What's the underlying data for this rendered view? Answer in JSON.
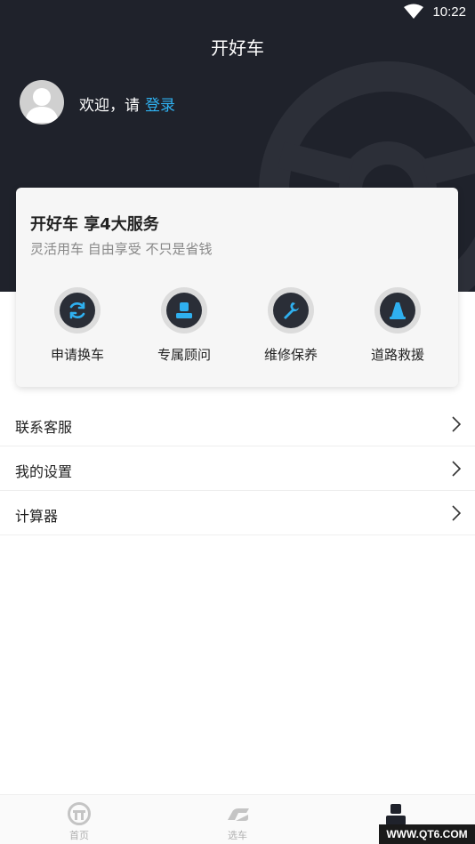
{
  "status_bar": {
    "time": "10:22"
  },
  "header": {
    "title": "开好车",
    "welcome_text": "欢迎，请",
    "login_label": "登录"
  },
  "service_card": {
    "title": "开好车 享4大服务",
    "subtitle": "灵活用车 自由享受 不只是省钱",
    "items": [
      {
        "label": "申请换车",
        "icon": "refresh-icon"
      },
      {
        "label": "专属顾问",
        "icon": "consultant-icon"
      },
      {
        "label": "维修保养",
        "icon": "wrench-icon"
      },
      {
        "label": "道路救援",
        "icon": "traffic-cone-icon"
      }
    ]
  },
  "menu": {
    "items": [
      {
        "label": "联系客服"
      },
      {
        "label": "我的设置"
      },
      {
        "label": "计算器"
      }
    ]
  },
  "tabbar": {
    "tabs": [
      {
        "label": "首页",
        "icon": "home-wheel-icon"
      },
      {
        "label": "选车",
        "icon": "car-icon"
      },
      {
        "label": "",
        "icon": "profile-icon",
        "active": true
      }
    ]
  },
  "watermark": "WWW.QT6.COM",
  "colors": {
    "header_bg": "#1f222b",
    "accent": "#2fb0ef",
    "icon_bg": "#2a2e37"
  }
}
